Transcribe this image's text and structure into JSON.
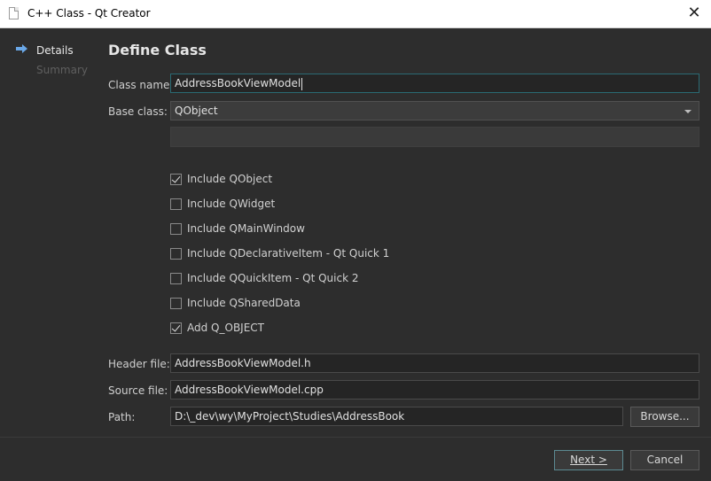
{
  "window": {
    "title": "C++ Class - Qt Creator"
  },
  "nav": {
    "items": [
      {
        "label": "Details"
      },
      {
        "label": "Summary"
      }
    ]
  },
  "page": {
    "heading": "Define Class"
  },
  "form": {
    "class_name_label": "Class name:",
    "class_name_value": "AddressBookViewModel",
    "base_class_label": "Base class:",
    "base_class_value": "QObject",
    "checkboxes": [
      {
        "label": "Include QObject",
        "checked": true
      },
      {
        "label": "Include QWidget",
        "checked": false
      },
      {
        "label": "Include QMainWindow",
        "checked": false
      },
      {
        "label": "Include QDeclarativeItem - Qt Quick 1",
        "checked": false
      },
      {
        "label": "Include QQuickItem - Qt Quick 2",
        "checked": false
      },
      {
        "label": "Include QSharedData",
        "checked": false
      },
      {
        "label": "Add Q_OBJECT",
        "checked": true
      }
    ],
    "header_file_label": "Header file:",
    "header_file_value": "AddressBookViewModel.h",
    "source_file_label": "Source file:",
    "source_file_value": "AddressBookViewModel.cpp",
    "path_label": "Path:",
    "path_value": "D:\\_dev\\wy\\MyProject\\Studies\\AddressBook",
    "browse_label": "Browse..."
  },
  "footer": {
    "next_label": "Next >",
    "cancel_label": "Cancel"
  },
  "colors": {
    "background": "#2d2d2d",
    "focus_border": "#2a6a73",
    "nav_arrow": "#6aa8e8"
  }
}
